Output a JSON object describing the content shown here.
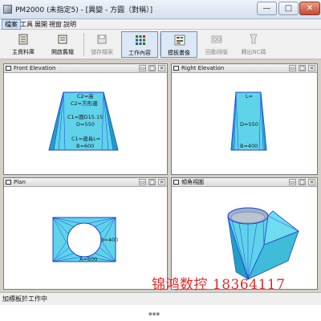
{
  "window": {
    "title": "PM2000 (未指定5) - [異變 - 方圓（對稱）]",
    "minimize_glyph": "—",
    "maximize_glyph": "□",
    "close_glyph": "✕"
  },
  "menu": {
    "items": [
      {
        "label": "檔案"
      },
      {
        "label": "工具"
      },
      {
        "label": "展開"
      },
      {
        "label": "視窗"
      },
      {
        "label": "說明"
      }
    ]
  },
  "toolbar": {
    "buttons": [
      {
        "label": "主資料庫",
        "icon": "database-icon"
      },
      {
        "label": "開啟舊檔",
        "icon": "open-file-icon"
      },
      {
        "label": "儲存檔案",
        "icon": "save-icon"
      },
      {
        "label": "工作內容",
        "icon": "work-content-icon"
      },
      {
        "label": "模板畫像",
        "icon": "template-icon"
      },
      {
        "label": "回動排版",
        "icon": "nesting-icon"
      },
      {
        "label": "轉出NC碼",
        "icon": "nc-export-icon"
      }
    ]
  },
  "views": {
    "front": {
      "title": "Front Elevation",
      "labels": {
        "top": "C2=高",
        "top_name": "C2=方形邊",
        "mid1": "C1=圓D15.15",
        "mid2": "D=550",
        "bottom1": "C1=邊長L=",
        "bottom2": "B=600"
      }
    },
    "right": {
      "title": "Right Elevation",
      "labels": {
        "top": "L=",
        "mid": "D=550",
        "bottom": "B=400"
      }
    },
    "plan": {
      "title": "Plan",
      "labels": {
        "right": "B=400",
        "bottom": "A=600"
      }
    },
    "iso": {
      "title": "傾角視圖"
    }
  },
  "watermark": {
    "text": "锦鸿数控 18364117"
  },
  "status": {
    "text": "加標板於工作中"
  },
  "colors": {
    "surface_fill": "#5fd3ea",
    "surface_dark": "#1f9fc2",
    "edge_line": "#1f3fd8",
    "iso_top": "#9fb0c7",
    "pressed_button": "#dce8f5",
    "watermark": "#e4282a"
  }
}
